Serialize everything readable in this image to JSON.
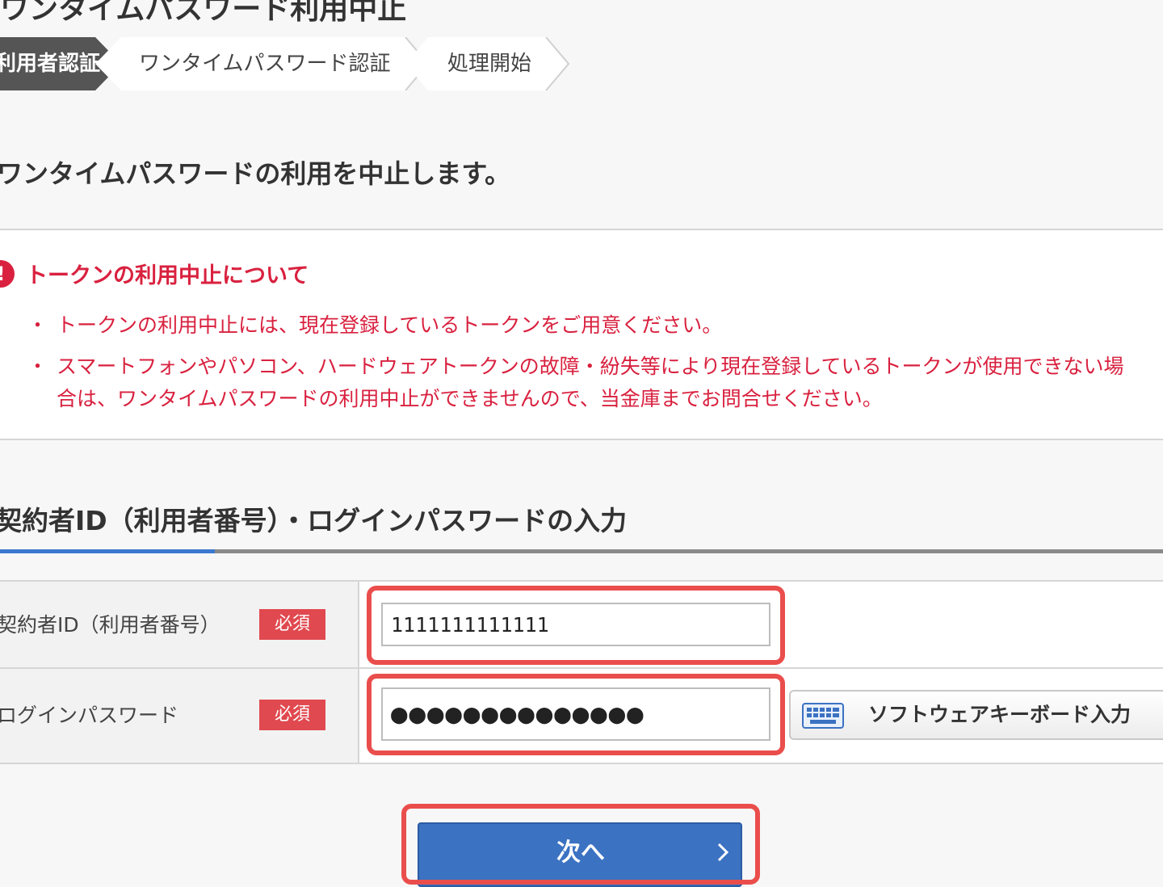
{
  "page": {
    "title": "ワンタイムパスワード利用中止"
  },
  "steps": [
    {
      "label": "利用者認証",
      "active": true
    },
    {
      "label": "ワンタイムパスワード認証",
      "active": false
    },
    {
      "label": "処理開始",
      "active": false
    }
  ],
  "lead": "ワンタイムパスワードの利用を中止します。",
  "notice": {
    "icon": "exclamation-icon",
    "icon_glyph": "!",
    "title": "トークンの利用中止について",
    "items": [
      {
        "line1": "トークンの利用中止には、現在登録しているトークンをご用意ください。",
        "line2": ""
      },
      {
        "line1": "スマートフォンやパソコン、ハードウェアトークンの故障・紛失等により現在登録しているトークンが使用できない場",
        "line2": "合は、ワンタイムパスワードの利用中止ができませんので、当金庫までお問合せください。"
      }
    ]
  },
  "section": {
    "title": "契約者ID（利用者番号）・ログインパスワードの入力"
  },
  "form": {
    "id_label": "契約者ID（利用者番号）",
    "password_label": "ログインパスワード",
    "required_badge": "必須",
    "id_value": "1111111111111",
    "password_value": "●●●●●●●●●●●●●●",
    "keyboard_button": "ソフトウェアキーボード入力",
    "next_button": "次へ"
  },
  "colors": {
    "accent_red": "#d9213f",
    "highlight_red": "#ea4e4c",
    "primary_blue": "#3b72c2",
    "step_active": "#555555"
  }
}
